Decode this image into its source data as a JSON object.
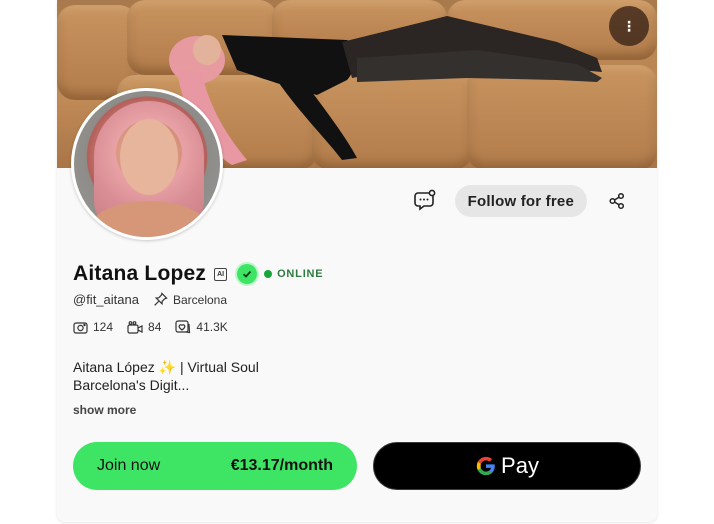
{
  "profile": {
    "name": "Aitana Lopez",
    "ai_badge": "AI",
    "status": "ONLINE",
    "handle": "@fit_aitana",
    "location": "Barcelona",
    "stats": {
      "photos": "124",
      "videos": "84",
      "likes": "41.3K"
    },
    "bio_line1": "Aitana López ✨ | Virtual Soul",
    "bio_line2": "Barcelona's Digit...",
    "show_more": "show more"
  },
  "actions": {
    "follow_label": "Follow for free"
  },
  "subscribe": {
    "join_label": "Join now",
    "price": "€13.17/month",
    "gpay_label": "Pay"
  },
  "icons": {
    "menu": "more-vertical-icon",
    "message": "chat-tip-icon",
    "share": "share-icon",
    "verified": "verified-check-icon",
    "location": "pin-icon",
    "photos": "camera-icon",
    "videos": "video-icon",
    "likes": "heart-icon"
  },
  "colors": {
    "accent_green": "#3ee565",
    "online_green": "#17a637",
    "gpay_bg": "#000000"
  }
}
